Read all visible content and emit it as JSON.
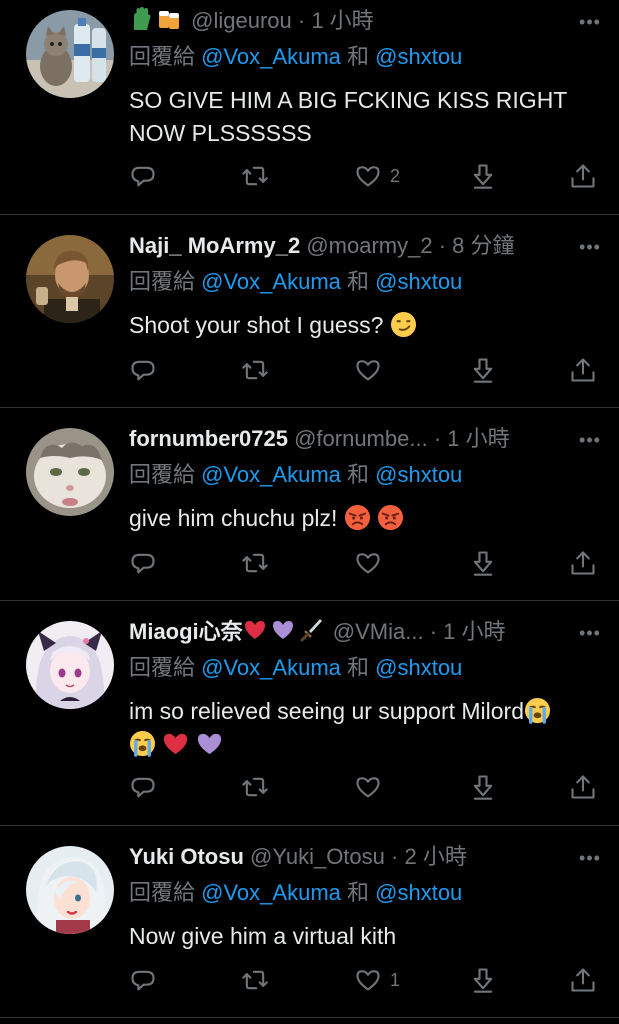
{
  "colors": {
    "background": "#000000",
    "text": "#e7e9ea",
    "secondary": "#71767b",
    "mention": "#1d9bf0",
    "divider": "#2f3336"
  },
  "tweets": [
    {
      "name": "",
      "name_icons": [
        "raised-back-of-hand-emoji",
        "beer-mugs-emoji"
      ],
      "handle": "@ligeurou",
      "dot": "·",
      "time": "1 小時",
      "reply_prefix": "回覆給",
      "reply_user1": "@Vox_Akuma",
      "reply_and": "和",
      "reply_user2": "@shxtou",
      "text": "SO GIVE HIM A BIG FCKING KISS RIGHT NOW PLSSSSSS",
      "like_count": "2",
      "avatar": "water-bottles-cat-photo"
    },
    {
      "name": "Naji_ MoArmy_2",
      "handle": "@moarmy_2",
      "dot": "·",
      "time": "8 分鐘",
      "reply_prefix": "回覆給",
      "reply_user1": "@Vox_Akuma",
      "reply_and": "和",
      "reply_user2": "@shxtou",
      "text": "Shoot your shot I guess?",
      "text_emojis": [
        "smirking-face-emoji"
      ],
      "like_count": "",
      "avatar": "man-portrait-photo"
    },
    {
      "name": "fornumber0725",
      "handle": "@fornumbe...",
      "dot": "·",
      "time": "1 小時",
      "reply_prefix": "回覆給",
      "reply_user1": "@Vox_Akuma",
      "reply_and": "和",
      "reply_user2": "@shxtou",
      "text": "give him chuchu plz!",
      "text_emojis": [
        "angry-face-emoji",
        "angry-face-emoji"
      ],
      "like_count": "",
      "avatar": "cat-photo"
    },
    {
      "name": "Miaogi心奈",
      "name_icons": [
        "red-heart-emoji",
        "purple-heart-emoji",
        "dagger-emoji"
      ],
      "handle": "@VMia...",
      "dot": "·",
      "time": "1 小時",
      "reply_prefix": "回覆給",
      "reply_user1": "@Vox_Akuma",
      "reply_and": "和",
      "reply_user2": "@shxtou",
      "text": "im so relieved seeing ur support Milord",
      "text_emojis": [
        "loudly-crying-face-emoji",
        "loudly-crying-face-emoji",
        "red-heart-emoji",
        "purple-heart-emoji"
      ],
      "like_count": "",
      "avatar": "anime-girl-avatar"
    },
    {
      "name": "Yuki Otosu",
      "handle": "@Yuki_Otosu",
      "dot": "·",
      "time": "2 小時",
      "reply_prefix": "回覆給",
      "reply_user1": "@Vox_Akuma",
      "reply_and": "和",
      "reply_user2": "@shxtou",
      "text": "Now give him a virtual kith",
      "like_count": "1",
      "avatar": "white-hair-girl-avatar"
    }
  ],
  "actions": {
    "reply": "reply-icon",
    "retweet": "retweet-icon",
    "like": "heart-icon",
    "share_down": "download-icon",
    "share_up": "share-icon",
    "more": "more-icon"
  }
}
